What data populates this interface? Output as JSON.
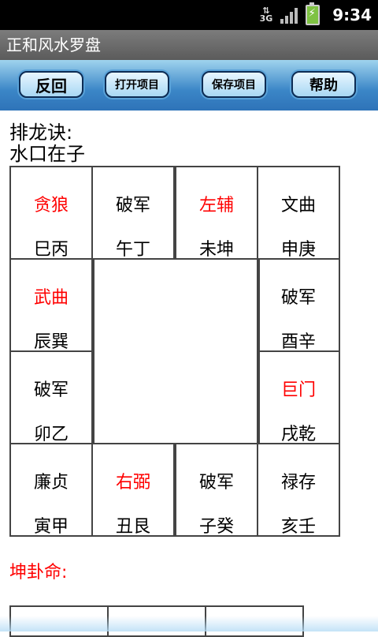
{
  "status": {
    "network": "3G",
    "time": "9:34"
  },
  "app": {
    "title": "正和风水罗盘"
  },
  "toolbar": {
    "back": "反回",
    "open": "打开项目",
    "save": "保存项目",
    "help": "帮助"
  },
  "formula": {
    "label": "排龙诀:",
    "water_mouth": "水口在子"
  },
  "grid": {
    "top": [
      {
        "star": "贪狼",
        "dirs": "巳丙",
        "star_color": "red"
      },
      {
        "star": "破军",
        "dirs": "午丁",
        "star_color": "black"
      },
      {
        "star": "左辅",
        "dirs": "未坤",
        "star_color": "red"
      },
      {
        "star": "文曲",
        "dirs": "申庚",
        "star_color": "black"
      }
    ],
    "left": [
      {
        "star": "武曲",
        "dirs": "辰巽",
        "star_color": "red"
      },
      {
        "star": "破军",
        "dirs": "卯乙",
        "star_color": "black"
      }
    ],
    "right": [
      {
        "star": "破军",
        "dirs": "酉辛",
        "star_color": "black"
      },
      {
        "star": "巨门",
        "dirs": "戌乾",
        "star_color": "red"
      }
    ],
    "bottom": [
      {
        "star": "廉贞",
        "dirs": "寅甲",
        "star_color": "black"
      },
      {
        "star": "右弼",
        "dirs": "丑艮",
        "star_color": "red"
      },
      {
        "star": "破军",
        "dirs": "子癸",
        "star_color": "black"
      },
      {
        "star": "禄存",
        "dirs": "亥壬",
        "star_color": "black"
      }
    ]
  },
  "gua": {
    "label": "坤卦命:"
  }
}
